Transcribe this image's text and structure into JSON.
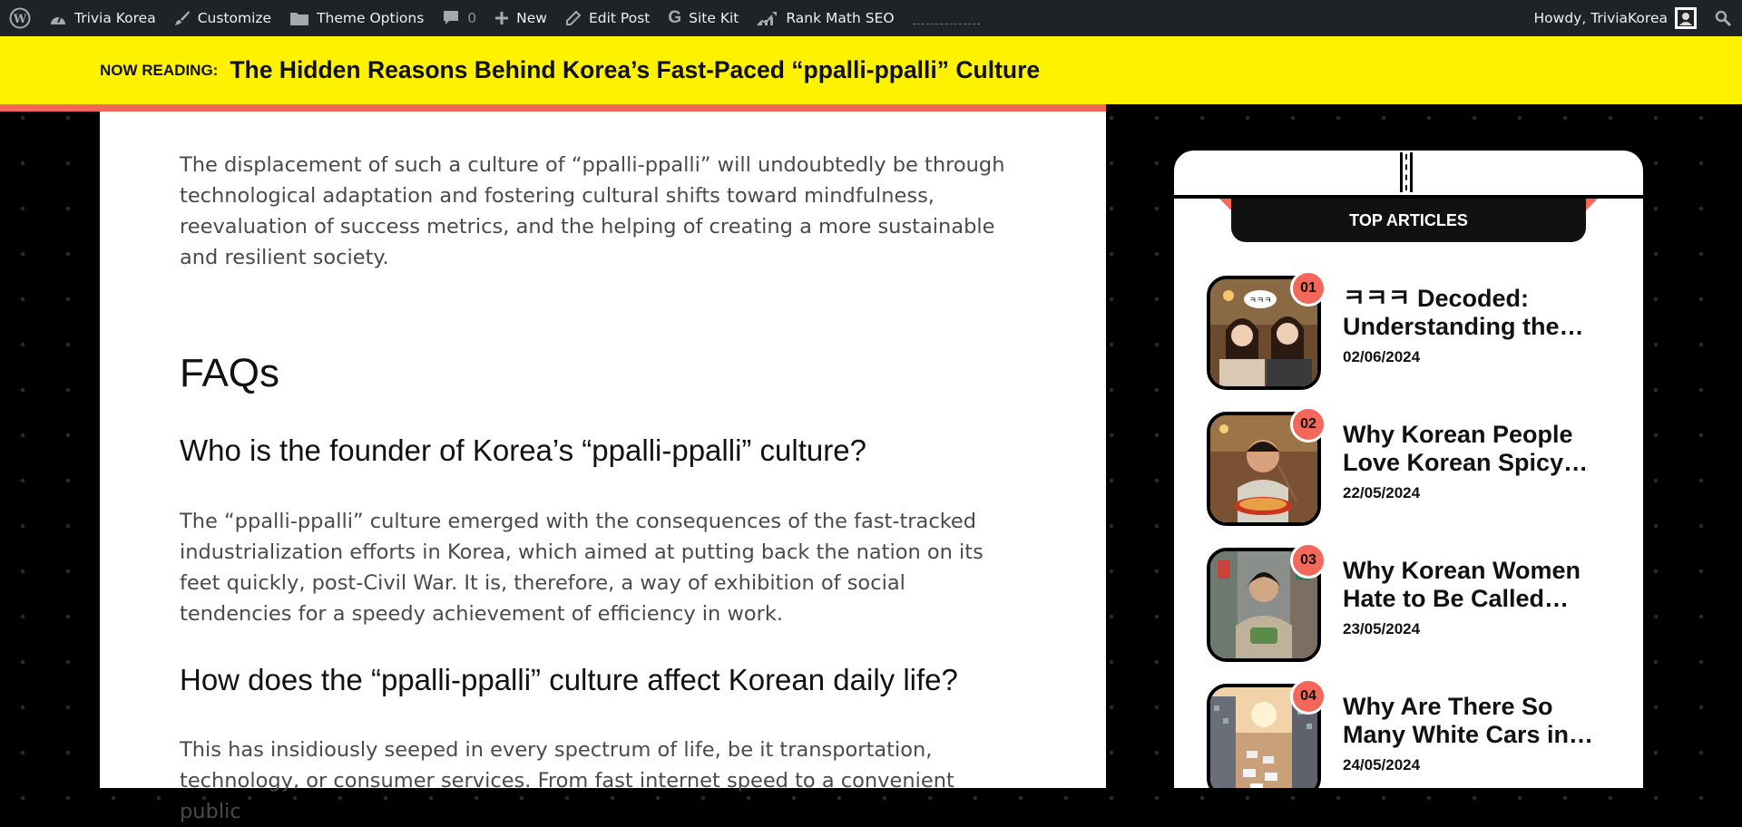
{
  "admin_bar": {
    "site_name": "Trivia Korea",
    "customize": "Customize",
    "theme_options": "Theme Options",
    "comments_count": "0",
    "new": "New",
    "edit_post": "Edit Post",
    "site_kit": "Site Kit",
    "rank_math": "Rank Math SEO",
    "howdy": "Howdy, TriviaKorea"
  },
  "now_reading": {
    "label": "NOW READING:",
    "title": "The Hidden Reasons Behind Korea’s Fast-Paced “ppalli-ppalli” Culture",
    "progress_fraction": 0.635
  },
  "article": {
    "intro_paragraph": "The displacement of such a culture of “ppalli-ppalli” will undoubtedly be through technological adaptation and fostering cultural shifts toward mindfulness, reevaluation of success metrics, and the helping of creating a more sustainable and resilient society.",
    "faqs_heading": "FAQs",
    "faq1_question": "Who is the founder of Korea’s “ppalli-ppalli” culture?",
    "faq1_answer": "The “ppalli-ppalli” culture emerged with the consequences of the fast-tracked industrialization efforts in Korea, which aimed at putting back the nation on its feet quickly, post-Civil War. It is, therefore, a way of exhibition of social tendencies for a speedy achievement of efficiency in work.",
    "faq2_question": "How does the “ppalli-ppalli” culture affect Korean daily life?",
    "faq2_answer": "This has insidiously seeped in every spectrum of life, be it transportation, technology, or consumer services. From fast internet speed to a convenient public"
  },
  "sidebar": {
    "header": "TOP ARTICLES",
    "items": [
      {
        "rank": "01",
        "title": "ㅋㅋㅋ Decoded: Understanding the…",
        "date": "02/06/2024"
      },
      {
        "rank": "02",
        "title": "Why Korean People Love Korean Spicy…",
        "date": "22/05/2024"
      },
      {
        "rank": "03",
        "title": "Why Korean Women Hate to Be Called…",
        "date": "23/05/2024"
      },
      {
        "rank": "04",
        "title": "Why Are There So Many White Cars in…",
        "date": "24/05/2024"
      }
    ]
  },
  "icons": {
    "wp": "wordpress-logo-icon",
    "customize": "paintbrush-icon",
    "theme_options": "folder-icon",
    "comments": "comment-bubble-icon",
    "new": "plus-icon",
    "edit": "pencil-icon",
    "site_kit": "google-g-icon",
    "rank_math": "chart-icon",
    "search": "search-icon"
  },
  "colors": {
    "accent_yellow": "#fff200",
    "accent_coral": "#f4685c",
    "admin_bar": "#1d2327"
  }
}
